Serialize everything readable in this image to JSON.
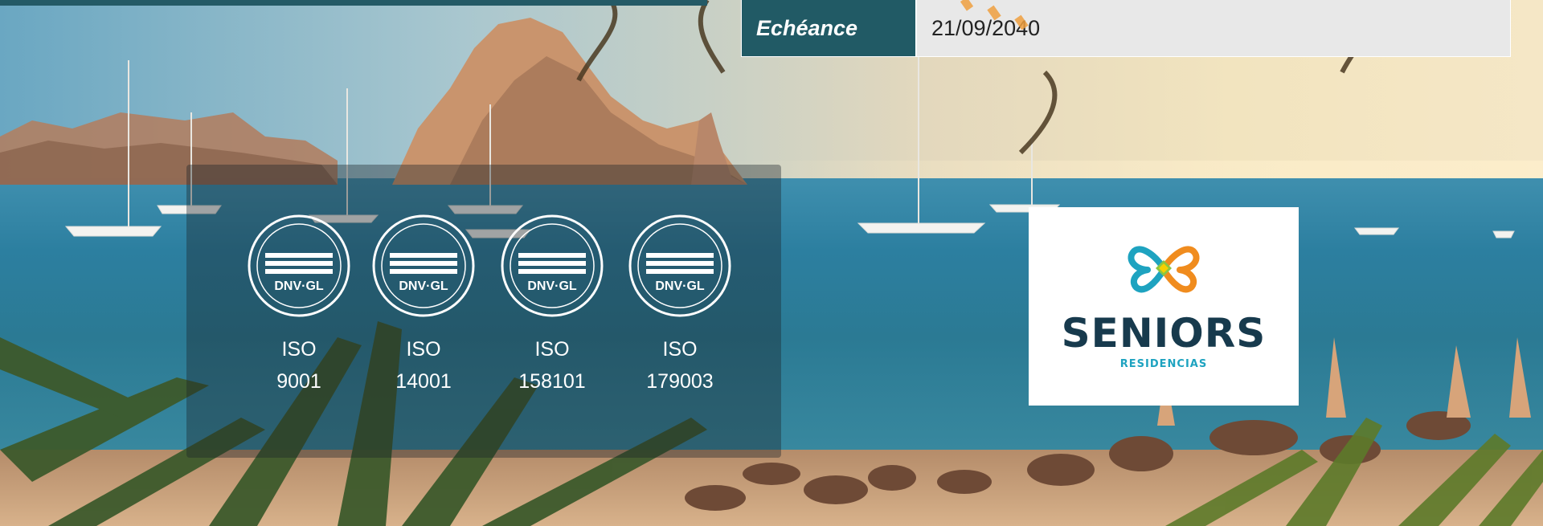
{
  "echeance": {
    "label": "Echéance",
    "value": "21/09/2040"
  },
  "certifications": [
    {
      "seal_text": "DNV·GL",
      "label": "ISO",
      "number": "9001"
    },
    {
      "seal_text": "DNV·GL",
      "label": "ISO",
      "number": "14001"
    },
    {
      "seal_text": "DNV·GL",
      "label": "ISO",
      "number": "158101"
    },
    {
      "seal_text": "DNV·GL",
      "label": "ISO",
      "number": "179003"
    }
  ],
  "logo": {
    "name": "SENIORS",
    "subtitle": "RESIDENCIAS"
  },
  "colors": {
    "header_dark": "#215a65",
    "value_bg": "#e8e8e8",
    "logo_navy": "#173a4d",
    "logo_teal": "#1ea3c0",
    "logo_orange": "#f08c1e",
    "logo_green": "#8dc63f"
  }
}
